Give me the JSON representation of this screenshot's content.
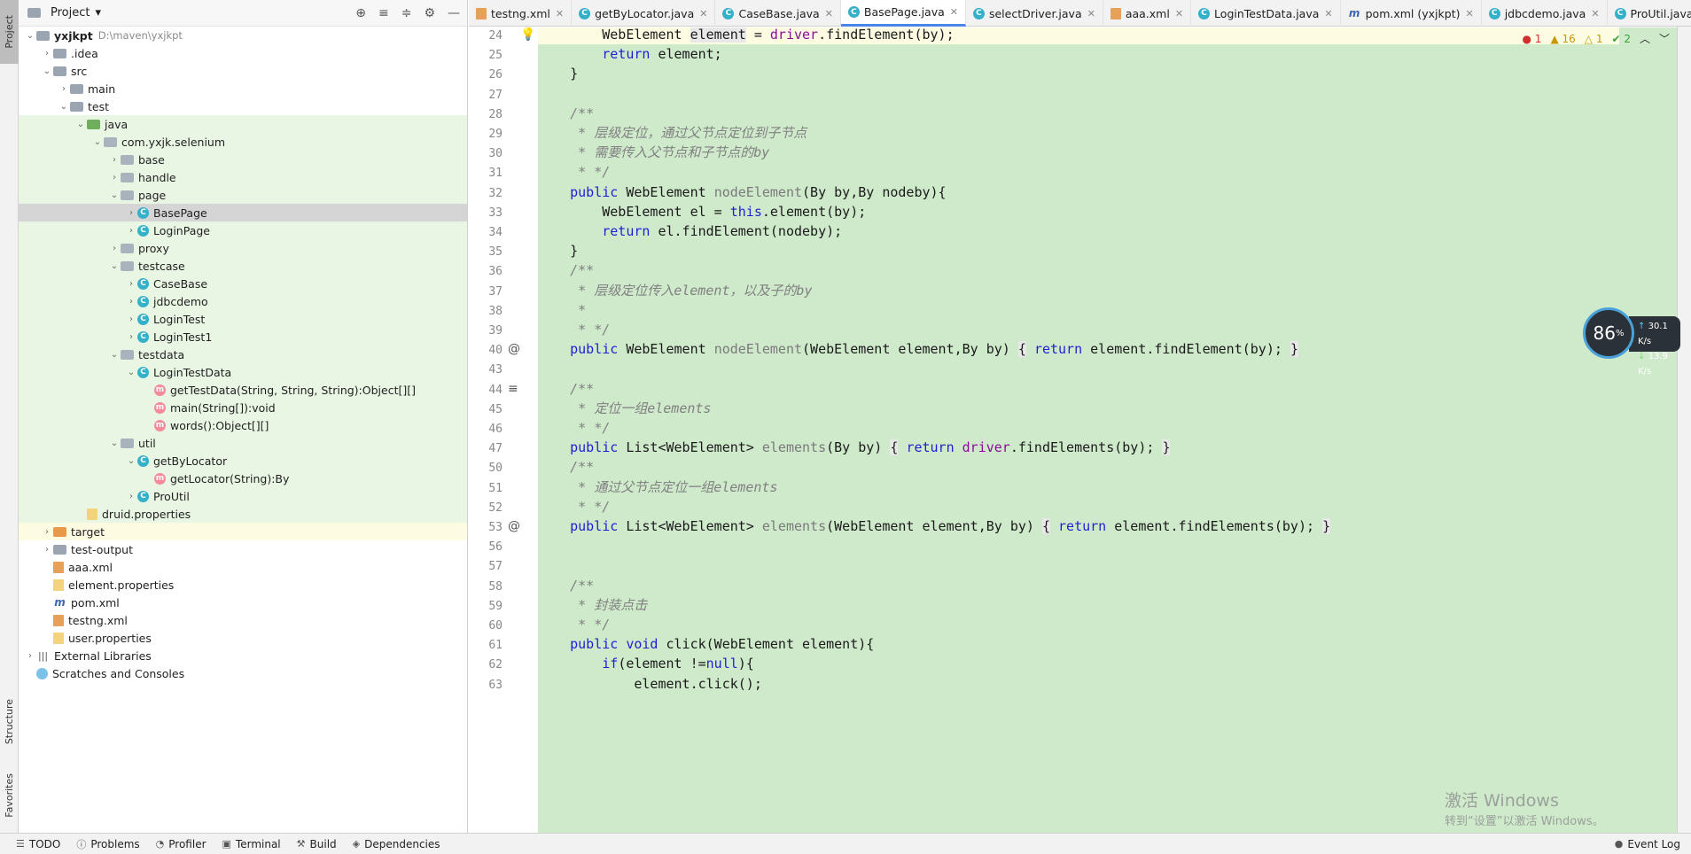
{
  "left_strip": {
    "project": "Project",
    "structure": "Structure",
    "favorites": "Favorites"
  },
  "project_panel": {
    "title": "Project",
    "root_name": "yxjkpt",
    "root_path": "D:\\maven\\yxjkpt",
    "tree": [
      {
        "label": "yxjkpt",
        "icon": "folder",
        "depth": 0,
        "arrow": "down",
        "hl": ""
      },
      {
        "label": ".idea",
        "icon": "folder",
        "depth": 1,
        "arrow": "right",
        "hl": ""
      },
      {
        "label": "src",
        "icon": "folder",
        "depth": 1,
        "arrow": "down",
        "hl": ""
      },
      {
        "label": "main",
        "icon": "folder",
        "depth": 2,
        "arrow": "right",
        "hl": ""
      },
      {
        "label": "test",
        "icon": "folder",
        "depth": 2,
        "arrow": "down",
        "hl": ""
      },
      {
        "label": "java",
        "icon": "folder-green",
        "depth": 3,
        "arrow": "down",
        "hl": "green"
      },
      {
        "label": "com.yxjk.selenium",
        "icon": "pkg",
        "depth": 4,
        "arrow": "down",
        "hl": "green"
      },
      {
        "label": "base",
        "icon": "pkg",
        "depth": 5,
        "arrow": "right",
        "hl": "green"
      },
      {
        "label": "handle",
        "icon": "pkg",
        "depth": 5,
        "arrow": "right",
        "hl": "green"
      },
      {
        "label": "page",
        "icon": "pkg",
        "depth": 5,
        "arrow": "down",
        "hl": "green"
      },
      {
        "label": "BasePage",
        "icon": "class",
        "depth": 6,
        "arrow": "right",
        "hl": "selected"
      },
      {
        "label": "LoginPage",
        "icon": "class",
        "depth": 6,
        "arrow": "right",
        "hl": "green"
      },
      {
        "label": "proxy",
        "icon": "pkg",
        "depth": 5,
        "arrow": "right",
        "hl": "green"
      },
      {
        "label": "testcase",
        "icon": "pkg",
        "depth": 5,
        "arrow": "down",
        "hl": "green"
      },
      {
        "label": "CaseBase",
        "icon": "class",
        "depth": 6,
        "arrow": "right",
        "hl": "green"
      },
      {
        "label": "jdbcdemo",
        "icon": "class",
        "depth": 6,
        "arrow": "right",
        "hl": "green"
      },
      {
        "label": "LoginTest",
        "icon": "class",
        "depth": 6,
        "arrow": "right",
        "hl": "green"
      },
      {
        "label": "LoginTest1",
        "icon": "class",
        "depth": 6,
        "arrow": "right",
        "hl": "green"
      },
      {
        "label": "testdata",
        "icon": "pkg",
        "depth": 5,
        "arrow": "down",
        "hl": "green"
      },
      {
        "label": "LoginTestData",
        "icon": "class",
        "depth": 6,
        "arrow": "down",
        "hl": "green"
      },
      {
        "label": "getTestData(String, String, String):Object[][]",
        "icon": "method",
        "depth": 7,
        "arrow": "",
        "hl": "green"
      },
      {
        "label": "main(String[]):void",
        "icon": "method",
        "depth": 7,
        "arrow": "",
        "hl": "green"
      },
      {
        "label": "words():Object[][]",
        "icon": "method",
        "depth": 7,
        "arrow": "",
        "hl": "green"
      },
      {
        "label": "util",
        "icon": "pkg",
        "depth": 5,
        "arrow": "down",
        "hl": "green"
      },
      {
        "label": "getByLocator",
        "icon": "class",
        "depth": 6,
        "arrow": "down",
        "hl": "green"
      },
      {
        "label": "getLocator(String):By",
        "icon": "method",
        "depth": 7,
        "arrow": "",
        "hl": "green"
      },
      {
        "label": "ProUtil",
        "icon": "class",
        "depth": 6,
        "arrow": "right",
        "hl": "green"
      },
      {
        "label": "druid.properties",
        "icon": "file",
        "depth": 3,
        "arrow": "",
        "hl": "green"
      },
      {
        "label": "target",
        "icon": "folder-orange",
        "depth": 1,
        "arrow": "right",
        "hl": "yellow"
      },
      {
        "label": "test-output",
        "icon": "folder",
        "depth": 1,
        "arrow": "right",
        "hl": ""
      },
      {
        "label": "aaa.xml",
        "icon": "xml",
        "depth": 1,
        "arrow": "",
        "hl": ""
      },
      {
        "label": "element.properties",
        "icon": "file",
        "depth": 1,
        "arrow": "",
        "hl": ""
      },
      {
        "label": "pom.xml",
        "icon": "maven",
        "depth": 1,
        "arrow": "",
        "hl": ""
      },
      {
        "label": "testng.xml",
        "icon": "xml",
        "depth": 1,
        "arrow": "",
        "hl": ""
      },
      {
        "label": "user.properties",
        "icon": "file",
        "depth": 1,
        "arrow": "",
        "hl": ""
      },
      {
        "label": "External Libraries",
        "icon": "libs",
        "depth": 0,
        "arrow": "right",
        "hl": ""
      },
      {
        "label": "Scratches and Consoles",
        "icon": "scratch",
        "depth": 0,
        "arrow": "",
        "hl": ""
      }
    ]
  },
  "tabs": [
    {
      "label": "testng.xml",
      "icon": "xml",
      "active": false
    },
    {
      "label": "getByLocator.java",
      "icon": "class",
      "active": false
    },
    {
      "label": "CaseBase.java",
      "icon": "class",
      "active": false
    },
    {
      "label": "BasePage.java",
      "icon": "class",
      "active": true
    },
    {
      "label": "selectDriver.java",
      "icon": "class",
      "active": false
    },
    {
      "label": "aaa.xml",
      "icon": "xml",
      "active": false
    },
    {
      "label": "LoginTestData.java",
      "icon": "class",
      "active": false
    },
    {
      "label": "pom.xml (yxjkpt)",
      "icon": "maven",
      "active": false
    },
    {
      "label": "jdbcdemo.java",
      "icon": "class",
      "active": false
    },
    {
      "label": "ProUtil.java",
      "icon": "class",
      "active": false
    }
  ],
  "inspections": {
    "errors": "1",
    "warnings": "16",
    "weak": "1",
    "ok": "2"
  },
  "code_lines": [
    {
      "num": "24",
      "mark": "bulb",
      "html": "        WebElement <span class='hl'>element</span> = <span class='fld'>driver</span>.findElement(by);",
      "current": true
    },
    {
      "num": "25",
      "mark": "",
      "html": "        <span class='kw'>return</span> element;"
    },
    {
      "num": "26",
      "mark": "",
      "html": "    }"
    },
    {
      "num": "27",
      "mark": "",
      "html": ""
    },
    {
      "num": "28",
      "mark": "",
      "html": "    <span class='cm'>/**</span>"
    },
    {
      "num": "29",
      "mark": "",
      "html": "<span class='cm'>     * 层级定位，通过父节点定位到子节点</span>"
    },
    {
      "num": "30",
      "mark": "",
      "html": "<span class='cm'>     * 需要传入父节点和子节点的by</span>"
    },
    {
      "num": "31",
      "mark": "",
      "html": "<span class='cm'>     * */</span>"
    },
    {
      "num": "32",
      "mark": "",
      "html": "    <span class='kw'>public</span> WebElement <span class='mn'>nodeElement</span>(By by,By nodeby){"
    },
    {
      "num": "33",
      "mark": "",
      "html": "        WebElement el = <span class='kw'>this</span>.element(by);"
    },
    {
      "num": "34",
      "mark": "",
      "html": "        <span class='kw'>return</span> el.findElement(nodeby);"
    },
    {
      "num": "35",
      "mark": "",
      "html": "    }"
    },
    {
      "num": "36",
      "mark": "",
      "html": "    <span class='cm'>/**</span>"
    },
    {
      "num": "37",
      "mark": "",
      "html": "<span class='cm'>     * 层级定位传入element，以及子的by</span>"
    },
    {
      "num": "38",
      "mark": "",
      "html": "<span class='cm'>     *</span>"
    },
    {
      "num": "39",
      "mark": "",
      "html": "<span class='cm'>     * */</span>"
    },
    {
      "num": "40",
      "mark": "@",
      "html": "    <span class='kw'>public</span> WebElement <span class='mn'>nodeElement</span>(WebElement element,By by) <span class='hl'>{</span> <span class='kw'>return</span> element.findElement(by); <span class='hl'>}</span>"
    },
    {
      "num": "43",
      "mark": "",
      "html": ""
    },
    {
      "num": "44",
      "mark": "≡",
      "html": "    <span class='cm'>/**</span>"
    },
    {
      "num": "45",
      "mark": "",
      "html": "<span class='cm'>     * 定位一组elements</span>"
    },
    {
      "num": "46",
      "mark": "",
      "html": "<span class='cm'>     * */</span>"
    },
    {
      "num": "47",
      "mark": "",
      "html": "    <span class='kw'>public</span> List&lt;WebElement&gt; <span class='mn'>elements</span>(By by) <span class='hl'>{</span> <span class='kw'>return</span> <span class='fld'>driver</span>.findElements(by); <span class='hl'>}</span>"
    },
    {
      "num": "50",
      "mark": "",
      "html": "    <span class='cm'>/**</span>"
    },
    {
      "num": "51",
      "mark": "",
      "html": "<span class='cm'>     * 通过父节点定位一组elements</span>"
    },
    {
      "num": "52",
      "mark": "",
      "html": "<span class='cm'>     * */</span>"
    },
    {
      "num": "53",
      "mark": "@",
      "html": "    <span class='kw'>public</span> List&lt;WebElement&gt; <span class='mn'>elements</span>(WebElement element,By by) <span class='hl'>{</span> <span class='kw'>return</span> element.findElements(by); <span class='hl'>}</span>"
    },
    {
      "num": "56",
      "mark": "",
      "html": ""
    },
    {
      "num": "57",
      "mark": "",
      "html": ""
    },
    {
      "num": "58",
      "mark": "",
      "html": "    <span class='cm'>/**</span>"
    },
    {
      "num": "59",
      "mark": "",
      "html": "<span class='cm'>     * 封装点击</span>"
    },
    {
      "num": "60",
      "mark": "",
      "html": "<span class='cm'>     * */</span>"
    },
    {
      "num": "61",
      "mark": "",
      "html": "    <span class='kw'>public void</span> click(WebElement element){"
    },
    {
      "num": "62",
      "mark": "",
      "html": "        <span class='kw'>if</span>(element !=<span class='kw'>null</span>){"
    },
    {
      "num": "63",
      "mark": "",
      "html": "            element.click();"
    }
  ],
  "speed": {
    "percent": "86",
    "percent_unit": "%",
    "up": "30.1",
    "down": "13.9",
    "unit": "K/s"
  },
  "watermark": {
    "line1": "激活 Windows",
    "line2": "转到“设置”以激活 Windows。"
  },
  "bottom_bar": {
    "todo": "TODO",
    "problems": "Problems",
    "profiler": "Profiler",
    "terminal": "Terminal",
    "build": "Build",
    "dependencies": "Dependencies",
    "event_log": "Event Log"
  }
}
